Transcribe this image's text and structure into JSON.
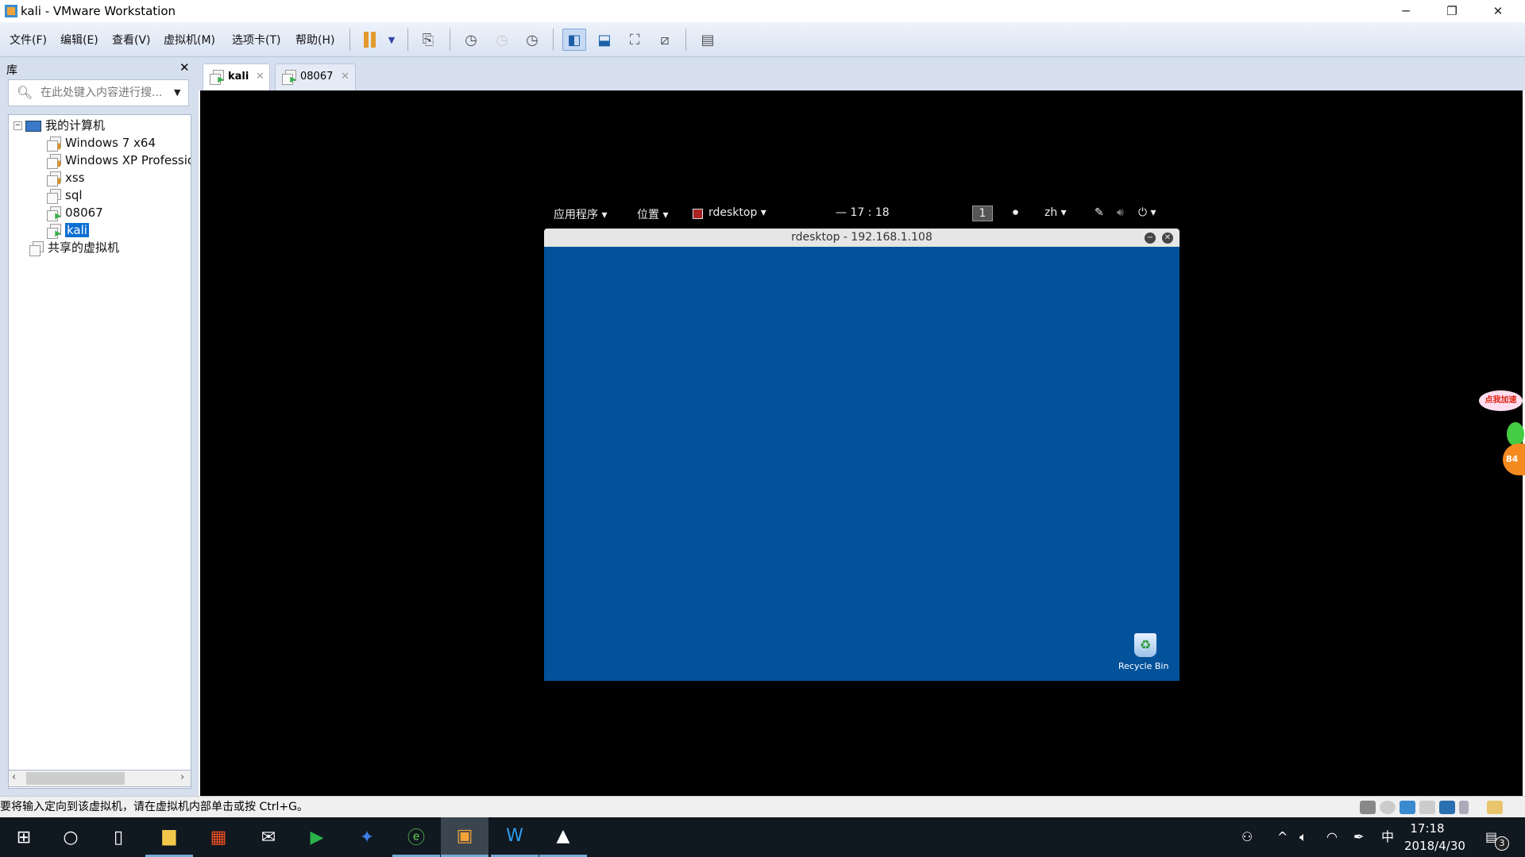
{
  "window": {
    "title": "kali - VMware Workstation",
    "minimize": "─",
    "restore": "❐",
    "close": "✕"
  },
  "menu": [
    "文件(F)",
    "编辑(E)",
    "查看(V)",
    "虚拟机(M)",
    "选项卡(T)",
    "帮助(H)"
  ],
  "toolbar_icons": [
    "pause-icon",
    "dropdown-icon",
    "send-ctrl-alt-del-icon",
    "snapshot-icon",
    "revert-snapshot-icon",
    "snapshot-manager-icon",
    "show-library-icon",
    "thumbnail-bar-icon",
    "fullscreen-icon",
    "unity-icon",
    "console-view-icon"
  ],
  "library": {
    "title": "库",
    "close": "✕",
    "search_placeholder": "在此处键入内容进行搜...",
    "tree": {
      "root": "我的计算机",
      "vms": [
        "Windows 7 x64",
        "Windows XP Professional",
        "xss",
        "sql",
        "08067",
        "kali"
      ],
      "selected": "kali",
      "shared": "共享的虚拟机"
    }
  },
  "tabs": [
    {
      "label": "kali",
      "active": true
    },
    {
      "label": "08067",
      "active": false
    }
  ],
  "guest": {
    "panel": {
      "apps": "应用程序 ▾",
      "places": "位置 ▾",
      "app": "rdesktop ▾",
      "clock": "— 17 : 18",
      "workspace": "1",
      "lang": "zh ▾",
      "power": "⏻ ▾"
    },
    "rdesktop": {
      "title": "rdesktop - 192.168.1.108",
      "desktop_color": "#01519b",
      "recycle_bin": "Recycle Bin"
    },
    "overlay_widget": {
      "label": "点我加速",
      "badge": "84"
    }
  },
  "status": {
    "message": "要将输入定向到该虚拟机，请在虚拟机内部单击或按 Ctrl+G。"
  },
  "taskbar": {
    "apps": [
      "start",
      "cortana",
      "task-view",
      "file-explorer",
      "store",
      "mail",
      "video-player",
      "feishu",
      "ie-browser",
      "vmware",
      "wps",
      "photos"
    ],
    "tray": {
      "ime": "中",
      "time": "17:18",
      "date": "2018/4/30",
      "notifications": "3"
    }
  }
}
